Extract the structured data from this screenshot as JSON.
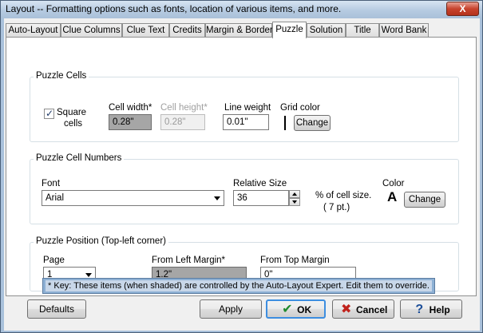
{
  "window": {
    "title": "Layout -- Formatting options such as fonts, location of various items, and more.",
    "close_label": "X"
  },
  "tabs": [
    {
      "label": "Auto-Layout"
    },
    {
      "label": "Clue Columns"
    },
    {
      "label": "Clue Text"
    },
    {
      "label": "Credits"
    },
    {
      "label": "Margin & Border"
    },
    {
      "label": "Puzzle",
      "active": true
    },
    {
      "label": "Solution"
    },
    {
      "label": "Title"
    },
    {
      "label": "Word Bank"
    }
  ],
  "puzzle_cells": {
    "title": "Puzzle Cells",
    "square_cells_line1": "Square",
    "square_cells_line2": "cells",
    "square_cells_checked": true,
    "cell_width_label": "Cell width*",
    "cell_width_value": "0.28\"",
    "cell_height_label": "Cell height*",
    "cell_height_value": "0.28\"",
    "line_weight_label": "Line weight",
    "line_weight_value": "0.01\"",
    "grid_color_label": "Grid color",
    "grid_color": "#000000",
    "change_label": "Change"
  },
  "cell_numbers": {
    "title": "Puzzle Cell Numbers",
    "font_label": "Font",
    "font_value": "Arial",
    "relative_size_label": "Relative Size",
    "relative_size_value": "36",
    "percent_label": "% of cell size.",
    "points_label": "( 7 pt.)",
    "color_label": "Color",
    "color_sample": "A",
    "change_label": "Change"
  },
  "puzzle_position": {
    "title": "Puzzle Position (Top-left corner)",
    "page_label": "Page",
    "page_value": "1",
    "left_margin_label": "From Left Margin*",
    "left_margin_value": "1.2\"",
    "top_margin_label": "From Top Margin",
    "top_margin_value": "0\""
  },
  "key_note": "* Key:  These items (when shaded) are controlled by the Auto-Layout Expert.  Edit them to override.",
  "buttons": {
    "defaults": "Defaults",
    "apply": "Apply",
    "ok": "OK",
    "cancel": "Cancel",
    "help": "Help"
  },
  "colors": {
    "ok_check": "#1f8a2e",
    "cancel_x": "#c0221b",
    "help_icon": "#1d4f99",
    "shaded_field": "#a6a6a6",
    "key_bar": "#8db0d4"
  }
}
